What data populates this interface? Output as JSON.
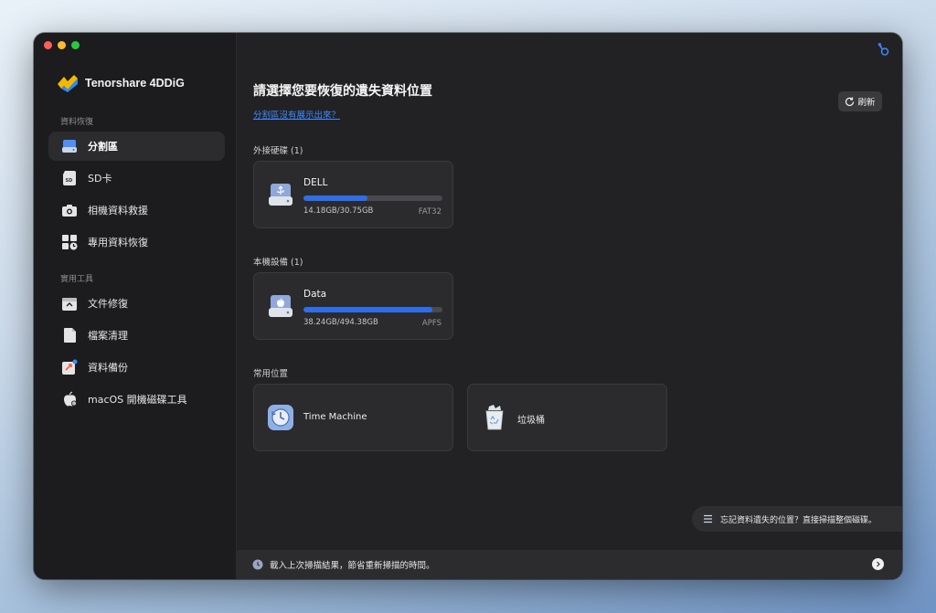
{
  "app": {
    "name": "Tenorshare 4DDiG"
  },
  "sidebar": {
    "section_recovery": "資料恢復",
    "section_tools": "實用工具",
    "recovery_items": [
      {
        "label": "分割區",
        "icon": "drive-icon",
        "active": true
      },
      {
        "label": "SD卡",
        "icon": "sd-card-icon",
        "active": false
      },
      {
        "label": "相機資料救援",
        "icon": "camera-icon",
        "active": false
      },
      {
        "label": "專用資料恢復",
        "icon": "special-recovery-icon",
        "active": false
      }
    ],
    "tool_items": [
      {
        "label": "文件修復",
        "icon": "file-repair-icon"
      },
      {
        "label": "檔案清理",
        "icon": "file-cleanup-icon"
      },
      {
        "label": "資料備份",
        "icon": "backup-icon"
      },
      {
        "label": "macOS 開機磁碟工具",
        "icon": "apple-icon"
      }
    ]
  },
  "main": {
    "title": "請選擇您要恢復的遺失資料位置",
    "help_link": "分割區沒有展示出來？",
    "refresh_label": "刷新",
    "groups": {
      "external": {
        "label": "外接硬碟 (1)",
        "drives": [
          {
            "name": "DELL",
            "size": "14.18GB/30.75GB",
            "fs": "FAT32",
            "used_fraction": 0.461
          }
        ]
      },
      "local": {
        "label": "本機設備 (1)",
        "drives": [
          {
            "name": "Data",
            "size": "38.24GB/494.38GB",
            "fs": "APFS",
            "used_fraction": 0.93
          }
        ]
      },
      "common": {
        "label": "常用位置",
        "locations": [
          {
            "name": "Time Machine",
            "icon": "time-machine-icon"
          },
          {
            "name": "垃圾桶",
            "icon": "trash-icon"
          }
        ]
      }
    },
    "hint": "忘記資料遺失的位置？直接掃描整個磁碟。",
    "bottom_bar": "載入上次掃描結果，節省重新掃描的時間。"
  },
  "colors": {
    "accent": "#2f6ee8",
    "link": "#3d8bff",
    "background": "#222225",
    "sidebar": "#1c1c1e"
  }
}
